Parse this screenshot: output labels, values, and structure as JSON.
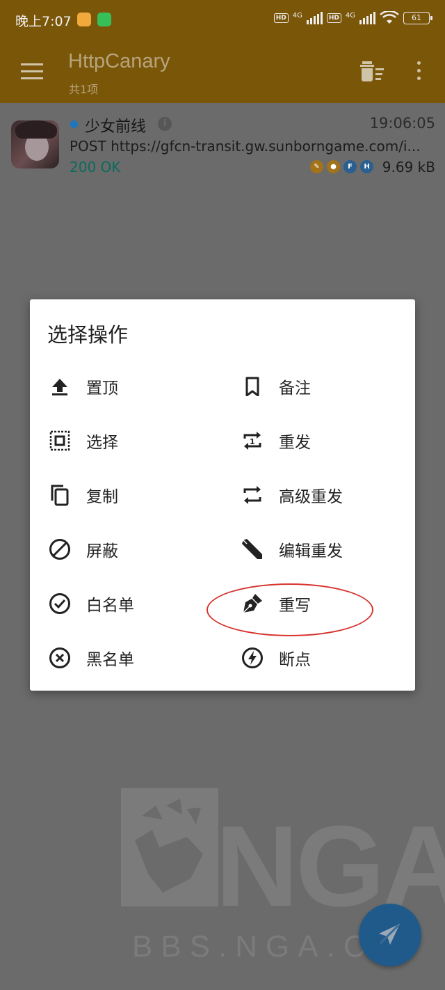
{
  "status_bar": {
    "time": "晚上7:07",
    "network1": "4G",
    "network2": "4G",
    "hd": "HD",
    "battery": "61"
  },
  "toolbar": {
    "title": "HttpCanary",
    "subtitle": "共1项"
  },
  "request": {
    "app_name": "少女前线",
    "time": "19:06:05",
    "url": "POST https://gfcn-transit.gw.sunborngame.com/i...",
    "status": "200 OK",
    "size": "9.69 kB",
    "badges": [
      {
        "letter": "",
        "color": "#c88a1a"
      },
      {
        "letter": "",
        "color": "#c88a1a"
      },
      {
        "letter": "F",
        "color": "#2d7bc4"
      },
      {
        "letter": "H",
        "color": "#2d7bc4"
      }
    ]
  },
  "dialog": {
    "title": "选择操作",
    "options": [
      {
        "label": "置顶",
        "icon": "upload-icon"
      },
      {
        "label": "备注",
        "icon": "bookmark-icon"
      },
      {
        "label": "选择",
        "icon": "select-all-icon"
      },
      {
        "label": "重发",
        "icon": "repeat-one-icon"
      },
      {
        "label": "复制",
        "icon": "copy-icon"
      },
      {
        "label": "高级重发",
        "icon": "repeat-icon"
      },
      {
        "label": "屏蔽",
        "icon": "block-icon"
      },
      {
        "label": "编辑重发",
        "icon": "edit-pencil-icon"
      },
      {
        "label": "白名单",
        "icon": "check-circle-icon"
      },
      {
        "label": "重写",
        "icon": "pen-nib-icon"
      },
      {
        "label": "黑名单",
        "icon": "cancel-circle-icon"
      },
      {
        "label": "断点",
        "icon": "breakpoint-icon"
      }
    ]
  },
  "watermark": {
    "letters": "NGA",
    "url": "BBS.NGA.CN"
  }
}
